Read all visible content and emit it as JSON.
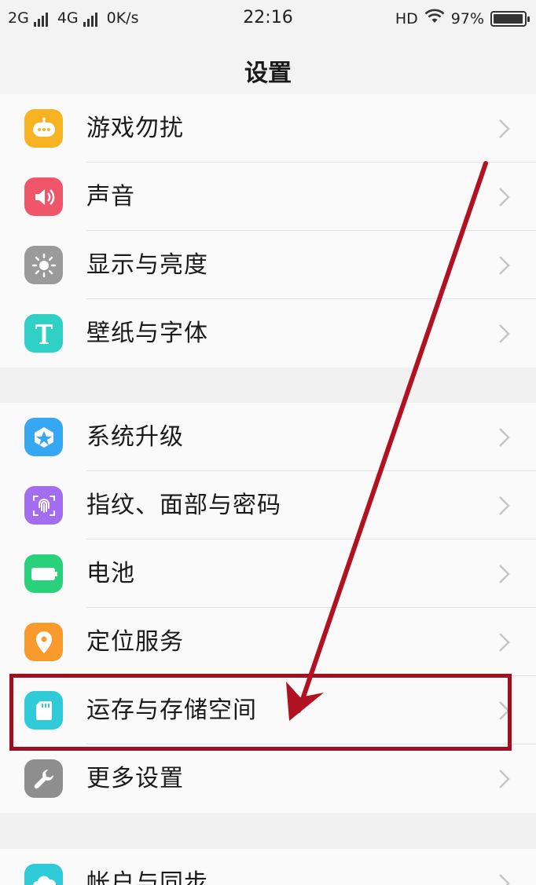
{
  "status_bar": {
    "sim1": "2G",
    "sim2": "4G",
    "speed": "0K/s",
    "time": "22:16",
    "hd": "HD",
    "battery": "97%",
    "battery_level": 0.97
  },
  "header": {
    "title": "设置"
  },
  "groups": [
    {
      "items": [
        {
          "label": "游戏勿扰",
          "icon": "gamepad-icon",
          "color": "#f8b323"
        },
        {
          "label": "声音",
          "icon": "speaker-icon",
          "color": "#f0566a"
        },
        {
          "label": "显示与亮度",
          "icon": "brightness-icon",
          "color": "#9a9a9a"
        },
        {
          "label": "壁纸与字体",
          "icon": "font-t-icon",
          "color": "#2fd0c6"
        }
      ]
    },
    {
      "items": [
        {
          "label": "系统升级",
          "icon": "upgrade-icon",
          "color": "#36a7f3"
        },
        {
          "label": "指纹、面部与密码",
          "icon": "fingerprint-icon",
          "color": "#a46df0"
        },
        {
          "label": "电池",
          "icon": "battery-icon",
          "color": "#28d17a"
        },
        {
          "label": "定位服务",
          "icon": "location-pin-icon",
          "color": "#f89a2c"
        },
        {
          "label": "运存与存储空间",
          "icon": "sd-card-icon",
          "color": "#2fcbd8"
        },
        {
          "label": "更多设置",
          "icon": "wrench-icon",
          "color": "#8e8e8e"
        }
      ]
    },
    {
      "items": [
        {
          "label": "帐户与同步",
          "icon": "sync-cloud-icon",
          "color": "#2fcbd8"
        }
      ]
    }
  ],
  "annotation": {
    "highlight_color": "#a01020",
    "arrow_color": "#b01222"
  }
}
